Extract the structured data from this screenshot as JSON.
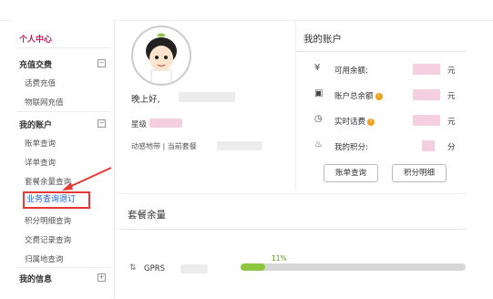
{
  "sidebar": {
    "title": "个人中心",
    "sections": [
      {
        "label": "充值交费",
        "toggle": "−"
      },
      {
        "label": "我的账户",
        "toggle": "−"
      },
      {
        "label": "我的信息",
        "toggle": "+"
      }
    ],
    "items": [
      "话费充值",
      "物联网充值",
      "账单查询",
      "详单查询",
      "套餐余量查询",
      "业务查询退订",
      "积分明细查询",
      "交费记录查询",
      "归属地查询"
    ]
  },
  "profile": {
    "greeting": "晚上好,",
    "level_label": "星级",
    "region_label": "动感地带 | 当前套餐"
  },
  "account": {
    "title": "我的账户",
    "rows": [
      {
        "icon": "¥",
        "label": "可用余额:",
        "unit": "元"
      },
      {
        "icon": "▣",
        "label": "账户总余额",
        "unit": "元"
      },
      {
        "icon": "◷",
        "label": "实时话费",
        "unit": "元"
      },
      {
        "icon": "♨",
        "label": "我的积分:",
        "unit": "分"
      }
    ],
    "buttons": {
      "bill": "账单查询",
      "points": "积分明细"
    }
  },
  "package": {
    "title": "套餐余量",
    "item": "GPRS",
    "icon": "⇅",
    "percent_label": "11%",
    "percent": 0.11
  },
  "colors": {
    "accent": "#c2185b",
    "active_link": "#1e63c9",
    "highlight_red": "#e53935",
    "progress_green": "#8cc63f"
  }
}
